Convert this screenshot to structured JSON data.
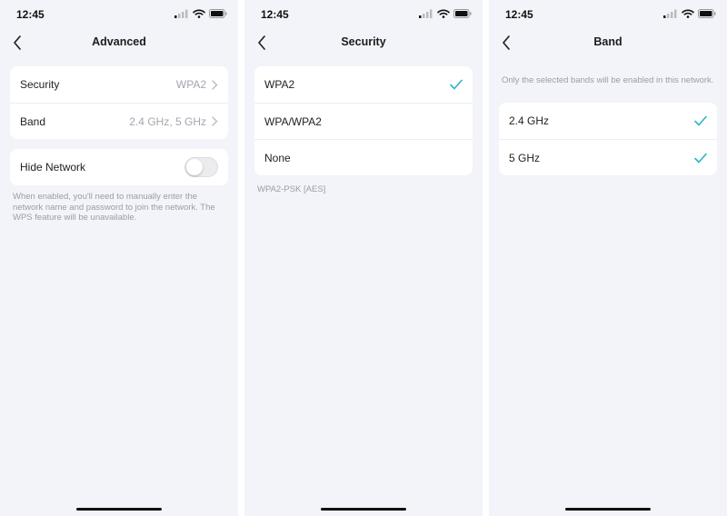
{
  "status_time": "12:45",
  "accent_color": "#2bb5c4",
  "advanced": {
    "title": "Advanced",
    "security_label": "Security",
    "security_value": "WPA2",
    "band_label": "Band",
    "band_value": "2.4 GHz, 5 GHz",
    "hide_network_label": "Hide Network",
    "hide_network_enabled": false,
    "note": "When enabled, you'll need to manually enter the network name and password to join the network. The WPS feature will be unavailable."
  },
  "security": {
    "title": "Security",
    "options": [
      {
        "label": "WPA2",
        "selected": true
      },
      {
        "label": "WPA/WPA2",
        "selected": false
      },
      {
        "label": "None",
        "selected": false
      }
    ],
    "note": "WPA2-PSK [AES]"
  },
  "band": {
    "title": "Band",
    "note": "Only the selected bands will be enabled in this network.",
    "options": [
      {
        "label": "2.4 GHz",
        "selected": true
      },
      {
        "label": "5 GHz",
        "selected": true
      }
    ]
  },
  "icons": [
    "back-chevron-icon",
    "signal-icon",
    "wifi-icon",
    "battery-icon",
    "chevron-right-icon",
    "checkmark-icon"
  ]
}
